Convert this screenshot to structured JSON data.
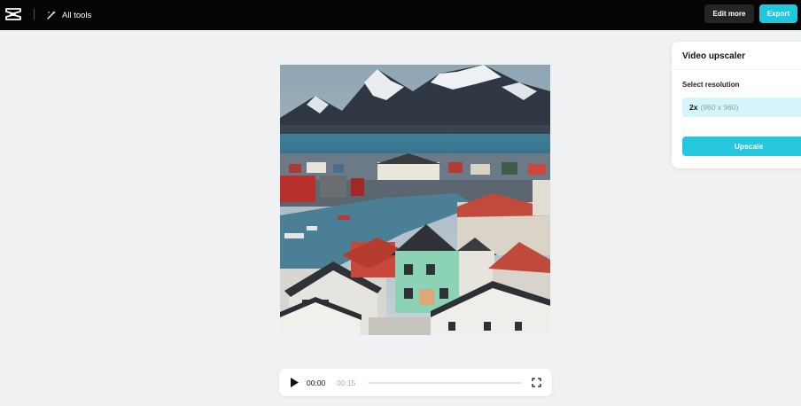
{
  "topbar": {
    "all_tools_label": "All tools",
    "edit_more_label": "Edit more",
    "export_label": "Export"
  },
  "player": {
    "current_time": "00:00",
    "total_time": "00:15"
  },
  "panel": {
    "title": "Video upscaler",
    "select_label": "Select resolution",
    "resolution_multiplier": "2x",
    "resolution_dims": "(960 x 960)",
    "upscale_label": "Upscale"
  },
  "icons": {
    "logo": "capcut-logo-icon",
    "all_tools": "magic-wand-icon",
    "play": "play-icon",
    "fullscreen": "fullscreen-icon"
  },
  "colors": {
    "accent": "#1fc8dd",
    "topbar": "#050505",
    "background": "#eff1f3",
    "selected_option": "#d6f5fa"
  }
}
